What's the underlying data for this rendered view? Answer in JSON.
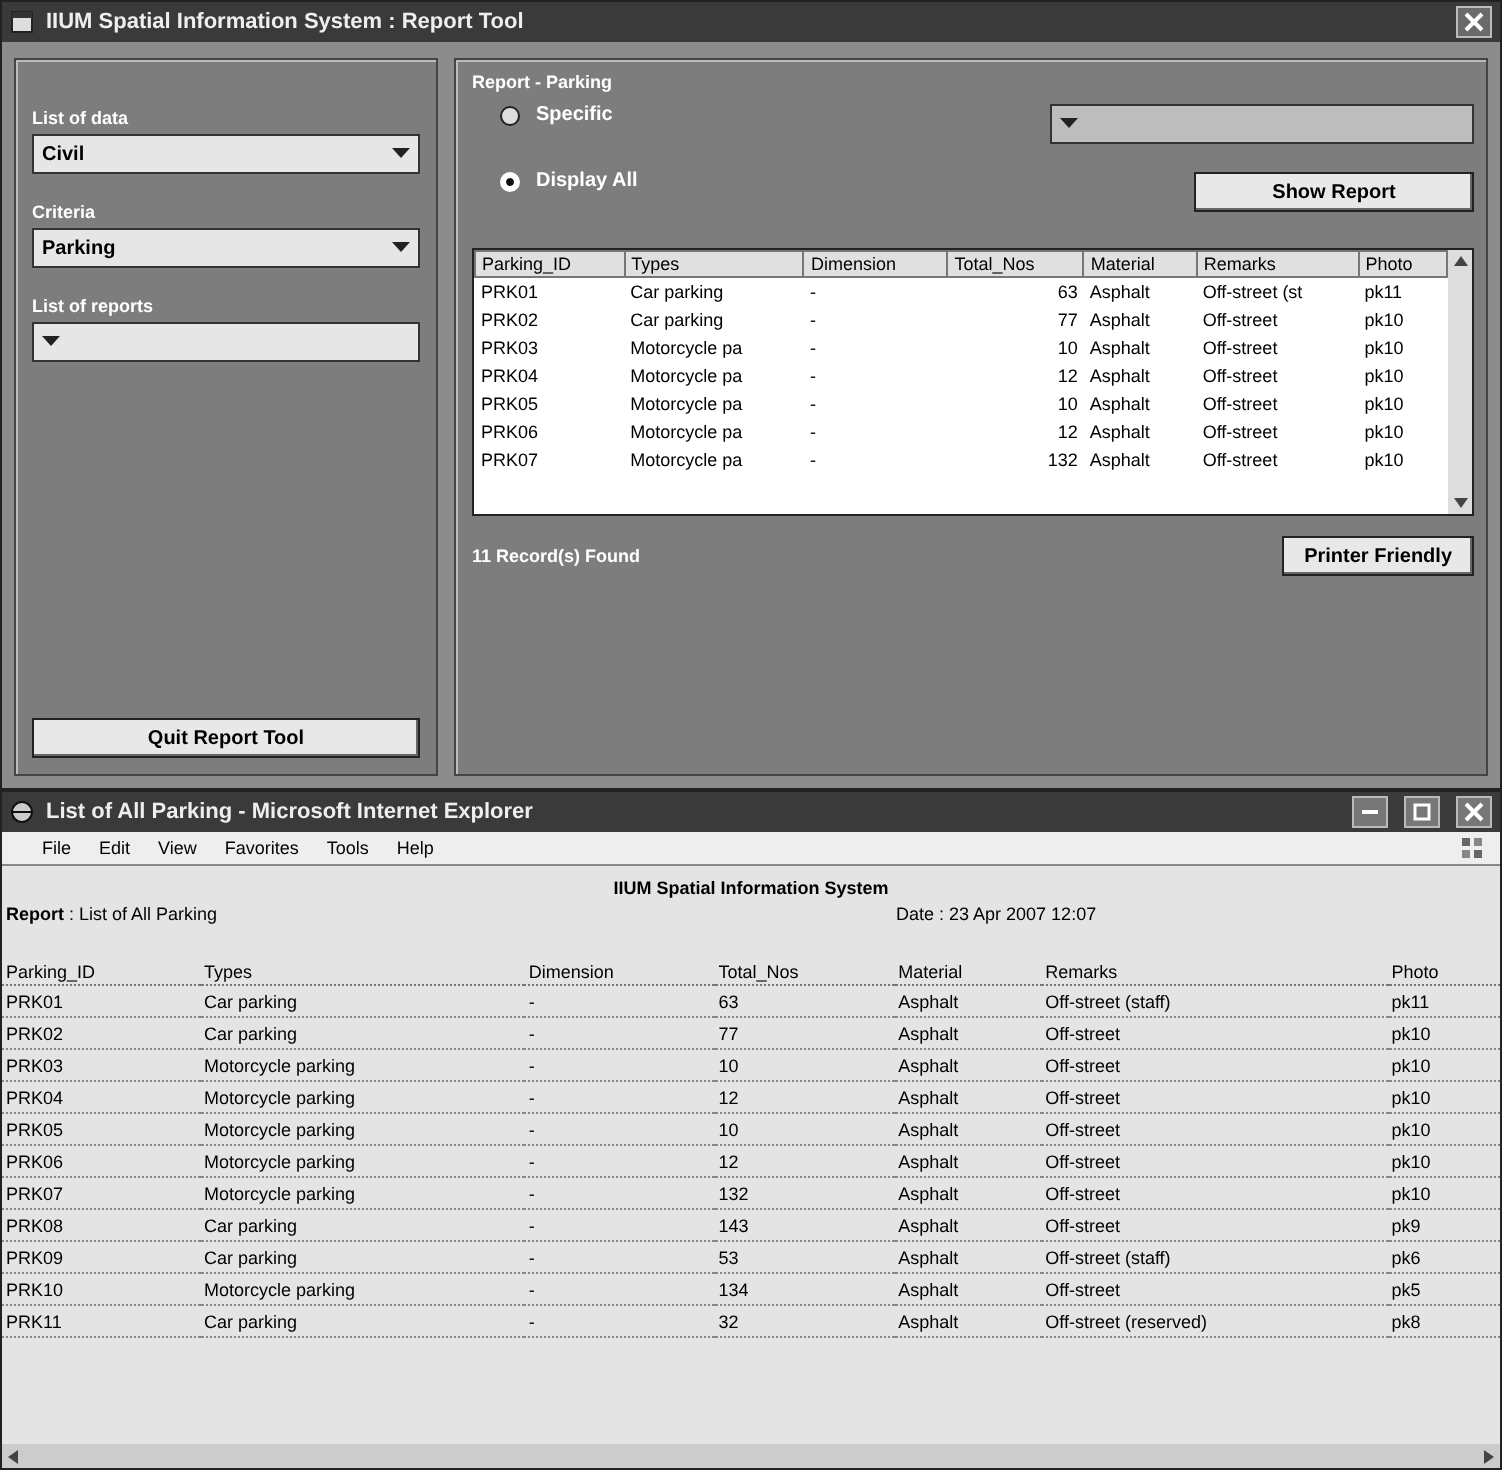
{
  "report_tool": {
    "title": "IIUM Spatial Information System : Report Tool",
    "fields": [
      {
        "label": "List of data",
        "value": "Civil"
      },
      {
        "label": "Criteria",
        "value": "Parking"
      },
      {
        "label": "List of reports"
      }
    ],
    "quit_button": "Quit Report Tool",
    "group_title": "Report - Parking",
    "options": [
      {
        "label": "Specific",
        "selected": false
      },
      {
        "label": "Display All",
        "selected": true
      }
    ],
    "show_button": "Show Report",
    "grid": {
      "columns": [
        "Parking_ID",
        "Types",
        "Dimension",
        "Total_Nos",
        "Material",
        "Remarks",
        "Photo"
      ],
      "rows": [
        [
          "PRK01",
          "Car parking",
          "-",
          "63",
          "Asphalt",
          "Off-street (st",
          "pk11"
        ],
        [
          "PRK02",
          "Car parking",
          "-",
          "77",
          "Asphalt",
          "Off-street",
          "pk10"
        ],
        [
          "PRK03",
          "Motorcycle pa",
          "-",
          "10",
          "Asphalt",
          "Off-street",
          "pk10"
        ],
        [
          "PRK04",
          "Motorcycle pa",
          "-",
          "12",
          "Asphalt",
          "Off-street",
          "pk10"
        ],
        [
          "PRK05",
          "Motorcycle pa",
          "-",
          "10",
          "Asphalt",
          "Off-street",
          "pk10"
        ],
        [
          "PRK06",
          "Motorcycle pa",
          "-",
          "12",
          "Asphalt",
          "Off-street",
          "pk10"
        ],
        [
          "PRK07",
          "Motorcycle pa",
          "-",
          "132",
          "Asphalt",
          "Off-street",
          "pk10"
        ]
      ]
    },
    "status": "11 Record(s) Found",
    "print_button": "Printer Friendly"
  },
  "browser": {
    "title": "List of All Parking - Microsoft Internet Explorer",
    "menu": [
      "File",
      "Edit",
      "View",
      "Favorites",
      "Tools",
      "Help"
    ],
    "heading": "IIUM Spatial Information System",
    "report_line": "**Report** : List of All Parking",
    "date": "Date : 23 Apr 2007 12:07",
    "columns": [
      "Parking_ID",
      "Types",
      "Dimension",
      "Total_Nos",
      "Material",
      "Remarks",
      "Photo"
    ],
    "rows": [
      [
        "PRK01",
        "Car parking",
        "-",
        "63",
        "Asphalt",
        "Off-street (staff)",
        "pk11"
      ],
      [
        "PRK02",
        "Car parking",
        "-",
        "77",
        "Asphalt",
        "Off-street",
        "pk10"
      ],
      [
        "PRK03",
        "Motorcycle parking",
        "-",
        "10",
        "Asphalt",
        "Off-street",
        "pk10"
      ],
      [
        "PRK04",
        "Motorcycle parking",
        "-",
        "12",
        "Asphalt",
        "Off-street",
        "pk10"
      ],
      [
        "PRK05",
        "Motorcycle parking",
        "-",
        "10",
        "Asphalt",
        "Off-street",
        "pk10"
      ],
      [
        "PRK06",
        "Motorcycle parking",
        "-",
        "12",
        "Asphalt",
        "Off-street",
        "pk10"
      ],
      [
        "PRK07",
        "Motorcycle parking",
        "-",
        "132",
        "Asphalt",
        "Off-street",
        "pk10"
      ],
      [
        "PRK08",
        "Car parking",
        "-",
        "143",
        "Asphalt",
        "Off-street",
        "pk9"
      ],
      [
        "PRK09",
        "Car parking",
        "-",
        "53",
        "Asphalt",
        "Off-street (staff)",
        "pk6"
      ],
      [
        "PRK10",
        "Motorcycle parking",
        "-",
        "134",
        "Asphalt",
        "Off-street",
        "pk5"
      ],
      [
        "PRK11",
        "Car parking",
        "-",
        "32",
        "Asphalt",
        "Off-street (reserved)",
        "pk8"
      ]
    ]
  }
}
